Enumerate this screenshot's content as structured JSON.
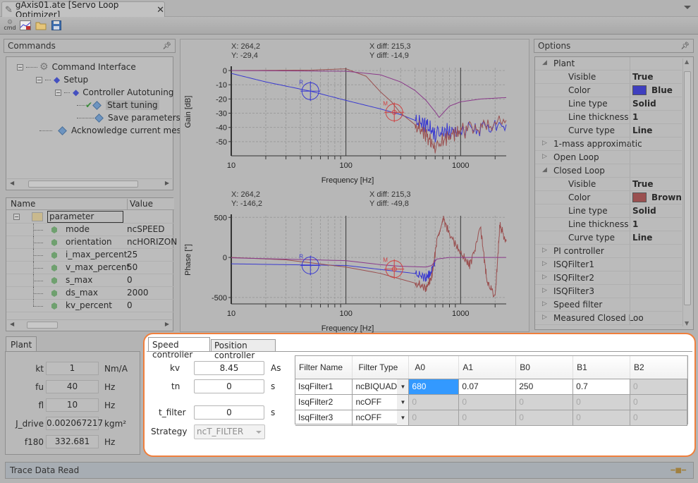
{
  "window": {
    "tab_title": "gAxis01.ate [Servo Loop Optimizer]",
    "tab_close": "✕"
  },
  "toolbar": {
    "icons": [
      "cmd-icon",
      "trace-chart-icon",
      "open-folder-icon",
      "save-icon"
    ],
    "cmd_label": "cmd"
  },
  "commands": {
    "title": "Commands",
    "tree": [
      {
        "label": "Command Interface",
        "icon": "gear-icon",
        "level": 0,
        "expanded": true
      },
      {
        "label": "Setup",
        "icon": "setup-icon",
        "level": 1,
        "expanded": true
      },
      {
        "label": "Controller Autotuning",
        "icon": "setup-icon",
        "level": 2,
        "expanded": true
      },
      {
        "label": "Start tuning",
        "icon": "command-icon",
        "level": 3,
        "checked": true,
        "selected": true
      },
      {
        "label": "Save parameters",
        "icon": "command-icon",
        "level": 3
      },
      {
        "label": "Acknowledge current messa",
        "icon": "command-icon",
        "level": 1
      }
    ]
  },
  "params": {
    "headers": {
      "name": "Name",
      "value": "Value"
    },
    "root": "parameter",
    "rows": [
      {
        "name": "mode",
        "value": "ncSPEED"
      },
      {
        "name": "orientation",
        "value": "ncHORIZON"
      },
      {
        "name": "i_max_percent",
        "value": "25"
      },
      {
        "name": "v_max_percent",
        "value": "50"
      },
      {
        "name": "s_max",
        "value": "0"
      },
      {
        "name": "ds_max",
        "value": "2000"
      },
      {
        "name": "kv_percent",
        "value": "0"
      }
    ]
  },
  "plant": {
    "tab": "Plant",
    "rows": [
      {
        "label": "kt",
        "value": "1",
        "unit": "Nm/A"
      },
      {
        "label": "fu",
        "value": "40",
        "unit": "Hz"
      },
      {
        "label": "fl",
        "value": "10",
        "unit": "Hz"
      },
      {
        "label": "J_drive",
        "value": "0.002067217",
        "unit": "kgm²"
      },
      {
        "label": "f180",
        "value": "332.681",
        "unit": "Hz"
      }
    ]
  },
  "chart_data": [
    {
      "type": "line",
      "title": "",
      "xlabel": "Frequency [Hz]",
      "ylabel": "Gain [dB]",
      "xscale": "log",
      "xlim": [
        10,
        2500
      ],
      "ylim": [
        -60,
        2
      ],
      "xticks": [
        "10",
        "100",
        "1000"
      ],
      "yticks": [
        "0",
        "-10",
        "-20",
        "-30",
        "-40",
        "-50"
      ],
      "grid": true,
      "cursor_readout": {
        "x": "X: 264,2",
        "y": "Y: -29,4",
        "xdiff": "X diff: 215,3",
        "ydiff": "Y diff: -14,9"
      },
      "markers": [
        {
          "label": "R",
          "x": 49,
          "y": -14.5,
          "color": "#3a3ad0"
        },
        {
          "label": "M",
          "x": 264,
          "y": -29.4,
          "color": "#d04040"
        }
      ],
      "series": [
        {
          "name": "Plant",
          "color": "#3a3ad0",
          "x": [
            10,
            20,
            49,
            100,
            200,
            300,
            400,
            500,
            600,
            800,
            1000,
            1500,
            2500
          ],
          "y": [
            -2,
            -8,
            -14.5,
            -21,
            -27,
            -31,
            -35,
            -38,
            -45,
            -42,
            -44,
            -40,
            -38
          ]
        },
        {
          "name": "Closed Loop",
          "color": "#9a5050",
          "x": [
            10,
            50,
            100,
            150,
            200,
            250,
            300,
            400,
            500,
            600,
            800,
            1000,
            1500,
            2500
          ],
          "y": [
            0,
            0.3,
            1.2,
            -4,
            -15,
            -22,
            -30,
            -38,
            -45,
            -55,
            -45,
            -43,
            -40,
            -35
          ]
        },
        {
          "name": "Open Loop",
          "color": "#8a3a8a",
          "x": [
            10,
            100,
            200,
            300,
            400,
            500,
            600,
            650,
            700,
            800,
            1000,
            1500,
            2500
          ],
          "y": [
            0,
            -0.5,
            -3,
            -8,
            -14,
            -21,
            -29,
            -33,
            -30,
            -25,
            -22,
            -20,
            -19
          ]
        }
      ]
    },
    {
      "type": "line",
      "title": "",
      "xlabel": "Frequency [Hz]",
      "ylabel": "Phase [°]",
      "xscale": "log",
      "xlim": [
        10,
        2500
      ],
      "ylim": [
        -580,
        520
      ],
      "xticks": [
        "10",
        "100",
        "1000"
      ],
      "yticks": [
        "500",
        "0",
        "-500"
      ],
      "grid": true,
      "cursor_readout": {
        "x": "X: 264,2",
        "y": "Y: -146,2",
        "xdiff": "X diff: 215,3",
        "ydiff": "Y diff: -49,8"
      },
      "markers": [
        {
          "label": "R",
          "x": 49,
          "y": -100,
          "color": "#3a3ad0"
        },
        {
          "label": "M",
          "x": 264,
          "y": -146,
          "color": "#d04040"
        }
      ],
      "series": [
        {
          "name": "Plant",
          "color": "#3a3ad0",
          "x": [
            10,
            30,
            100,
            200,
            300,
            400,
            500,
            550,
            600
          ],
          "y": [
            -80,
            -90,
            -100,
            -150,
            -180,
            -200,
            -250,
            -200,
            -50
          ]
        },
        {
          "name": "Closed Loop",
          "color": "#9a5050",
          "x": [
            10,
            30,
            100,
            200,
            300,
            400,
            500,
            560,
            620,
            700,
            800,
            1000,
            1200,
            1500,
            1700,
            2000,
            2200,
            2500
          ],
          "y": [
            0,
            -30,
            -120,
            -200,
            -270,
            -320,
            -380,
            -250,
            200,
            500,
            300,
            50,
            -100,
            350,
            -300,
            -500,
            400,
            200
          ]
        },
        {
          "name": "Open Loop",
          "color": "#8a3a8a",
          "x": [
            10,
            100,
            200,
            300,
            500,
            560,
            620,
            800,
            1000,
            2500
          ],
          "y": [
            -5,
            -40,
            -90,
            -110,
            -120,
            -100,
            -20,
            0,
            0,
            0
          ]
        }
      ]
    }
  ],
  "options": {
    "title": "Options",
    "rows": [
      {
        "type": "cat",
        "label": "Plant",
        "expanded": true
      },
      {
        "type": "prop",
        "name": "Visible",
        "value": "True"
      },
      {
        "type": "color",
        "name": "Color",
        "value": "Blue",
        "swatch": "#3f3fbf"
      },
      {
        "type": "prop",
        "name": "Line type",
        "value": "Solid"
      },
      {
        "type": "prop",
        "name": "Line thickness",
        "value": "1"
      },
      {
        "type": "prop",
        "name": "Curve type",
        "value": "Line"
      },
      {
        "type": "cat",
        "label": "1-mass approximatic",
        "expanded": false
      },
      {
        "type": "cat",
        "label": "Open Loop",
        "expanded": false
      },
      {
        "type": "cat",
        "label": "Closed Loop",
        "expanded": true
      },
      {
        "type": "prop",
        "name": "Visible",
        "value": "True"
      },
      {
        "type": "color",
        "name": "Color",
        "value": "Brown",
        "swatch": "#9a5050"
      },
      {
        "type": "prop",
        "name": "Line type",
        "value": "Solid"
      },
      {
        "type": "prop",
        "name": "Line thickness",
        "value": "1"
      },
      {
        "type": "prop",
        "name": "Curve type",
        "value": "Line"
      },
      {
        "type": "cat",
        "label": "PI controller",
        "expanded": false
      },
      {
        "type": "cat",
        "label": "ISQFilter1",
        "expanded": false
      },
      {
        "type": "cat",
        "label": "ISQFilter2",
        "expanded": false
      },
      {
        "type": "cat",
        "label": "ISQFilter3",
        "expanded": false
      },
      {
        "type": "cat",
        "label": "Speed filter",
        "expanded": false
      },
      {
        "type": "cat",
        "label": "Measured Closed Loo",
        "expanded": false
      }
    ]
  },
  "controller": {
    "tabs": [
      "Speed controller",
      "Position controller"
    ],
    "active_tab": "Speed controller",
    "fields": [
      {
        "label": "kv",
        "value": "8.45",
        "unit": "As"
      },
      {
        "label": "tn",
        "value": "0",
        "unit": "s"
      },
      {
        "label": "t_filter",
        "value": "0",
        "unit": "s"
      }
    ],
    "strategy": {
      "label": "Strategy",
      "value": "ncT_FILTER"
    },
    "filter_table": {
      "headers": [
        "Filter Name",
        "Filter Type",
        "A0",
        "A1",
        "B0",
        "B1",
        "B2"
      ],
      "rows": [
        {
          "name": "IsqFilter1",
          "type": "ncBIQUAD",
          "A0": "680",
          "A1": "0.07",
          "B0": "250",
          "B1": "0.7",
          "B2": "0"
        },
        {
          "name": "IsqFilter2",
          "type": "ncOFF",
          "A0": "0",
          "A1": "0",
          "B0": "0",
          "B1": "0",
          "B2": "0"
        },
        {
          "name": "IsqFilter3",
          "type": "ncOFF",
          "A0": "0",
          "A1": "0",
          "B0": "0",
          "B1": "0",
          "B2": "0"
        }
      ]
    }
  },
  "status": {
    "text": "Trace Data Read"
  },
  "colors": {
    "accent_orange": "#f07f3c",
    "selection_blue": "#3399ff",
    "plant_blue": "#3a3ad0",
    "closed_loop_brown": "#9a5050",
    "open_loop_purple": "#8a3a8a"
  }
}
